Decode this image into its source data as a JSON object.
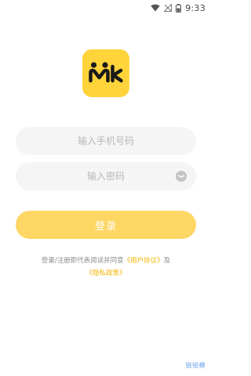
{
  "status_bar": {
    "time": "9:33",
    "icons": [
      "wifi-icon",
      "no-signal-icon",
      "battery-icon"
    ]
  },
  "logo": {
    "text": "MK",
    "color": "#ffd43a"
  },
  "login_form": {
    "phone_placeholder": "输入手机号码",
    "phone_value": "",
    "password_placeholder": "输入密码",
    "password_value": "",
    "login_button_label": "登录"
  },
  "agreement": {
    "prefix": "登录/注册即代表阅读并同意",
    "user_agreement_link": "《用户协议》",
    "conjunction": "及",
    "privacy_policy_link": "《隐私政策》"
  },
  "watermark": "锐锐模",
  "colors": {
    "accent": "#fdd664",
    "link": "#f4b400",
    "input_bg": "#f5f5f5"
  }
}
